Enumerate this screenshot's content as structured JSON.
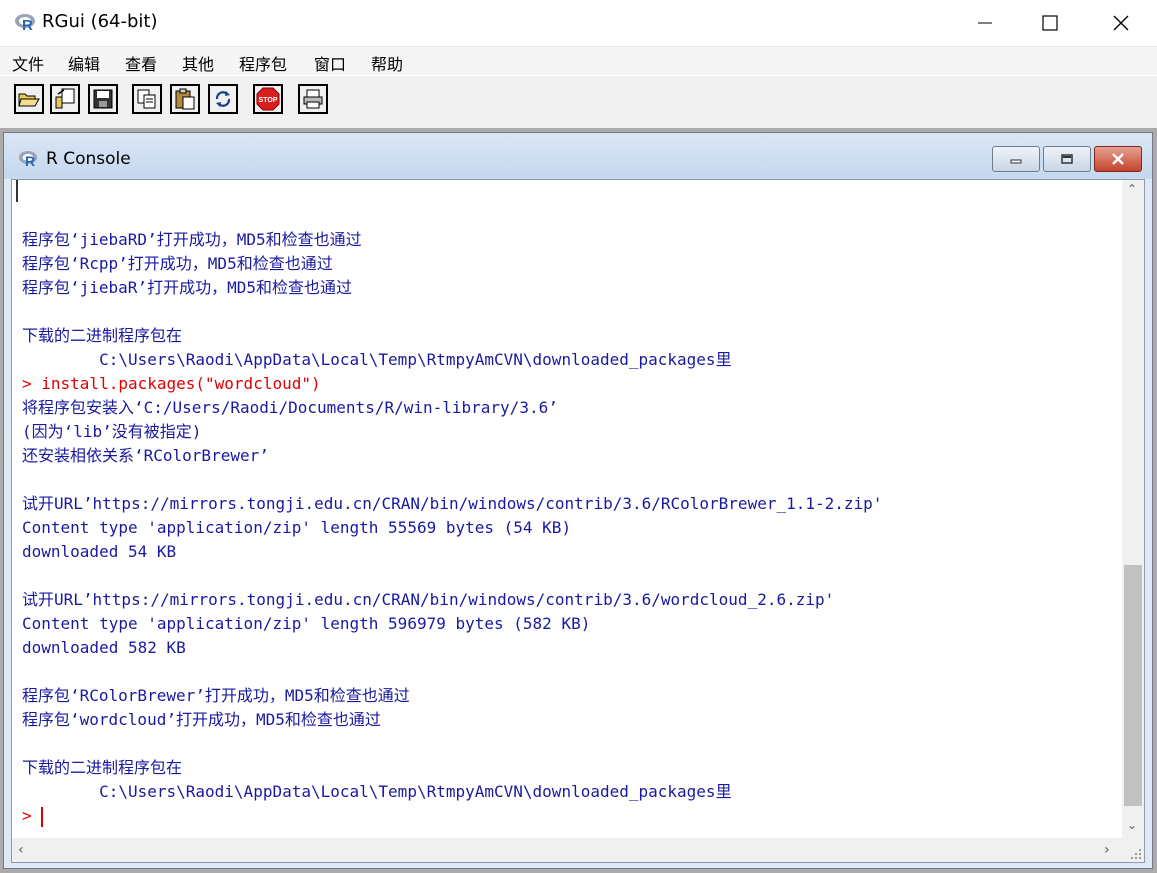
{
  "app": {
    "title": "RGui (64-bit)",
    "menu": [
      "文件",
      "编辑",
      "查看",
      "其他",
      "程序包",
      "窗口",
      "帮助"
    ]
  },
  "toolbar": {
    "icons": [
      "open-script-icon",
      "load-workspace-icon",
      "save-icon",
      "copy-icon",
      "paste-icon",
      "copy-paste-icon",
      "stop-icon",
      "print-icon"
    ]
  },
  "console": {
    "title": "R Console",
    "lines": [
      {
        "text": "",
        "type": "out"
      },
      {
        "text": "",
        "type": "out"
      },
      {
        "text": "程序包‘jiebaRD’打开成功，MD5和检查也通过",
        "type": "out"
      },
      {
        "text": "程序包‘Rcpp’打开成功，MD5和检查也通过",
        "type": "out"
      },
      {
        "text": "程序包‘jiebaR’打开成功，MD5和检查也通过",
        "type": "out"
      },
      {
        "text": "",
        "type": "out"
      },
      {
        "text": "下载的二进制程序包在",
        "type": "out"
      },
      {
        "text": "        C:\\Users\\Raodi\\AppData\\Local\\Temp\\RtmpyAmCVN\\downloaded_packages里",
        "type": "out"
      },
      {
        "text": "> install.packages(\"wordcloud\")",
        "type": "cmd"
      },
      {
        "text": "将程序包安装入‘C:/Users/Raodi/Documents/R/win-library/3.6’",
        "type": "out"
      },
      {
        "text": "(因为‘lib’没有被指定)",
        "type": "out"
      },
      {
        "text": "还安装相依关系‘RColorBrewer’",
        "type": "out"
      },
      {
        "text": "",
        "type": "out"
      },
      {
        "text": "试开URL’https://mirrors.tongji.edu.cn/CRAN/bin/windows/contrib/3.6/RColorBrewer_1.1-2.zip'",
        "type": "out"
      },
      {
        "text": "Content type 'application/zip' length 55569 bytes (54 KB)",
        "type": "out"
      },
      {
        "text": "downloaded 54 KB",
        "type": "out"
      },
      {
        "text": "",
        "type": "out"
      },
      {
        "text": "试开URL’https://mirrors.tongji.edu.cn/CRAN/bin/windows/contrib/3.6/wordcloud_2.6.zip'",
        "type": "out"
      },
      {
        "text": "Content type 'application/zip' length 596979 bytes (582 KB)",
        "type": "out"
      },
      {
        "text": "downloaded 582 KB",
        "type": "out"
      },
      {
        "text": "",
        "type": "out"
      },
      {
        "text": "程序包‘RColorBrewer’打开成功，MD5和检查也通过",
        "type": "out"
      },
      {
        "text": "程序包‘wordcloud’打开成功，MD5和检查也通过",
        "type": "out"
      },
      {
        "text": "",
        "type": "out"
      },
      {
        "text": "下载的二进制程序包在",
        "type": "out"
      },
      {
        "text": "        C:\\Users\\Raodi\\AppData\\Local\\Temp\\RtmpyAmCVN\\downloaded_packages里",
        "type": "out"
      },
      {
        "text": "> ",
        "type": "cmd"
      }
    ]
  }
}
